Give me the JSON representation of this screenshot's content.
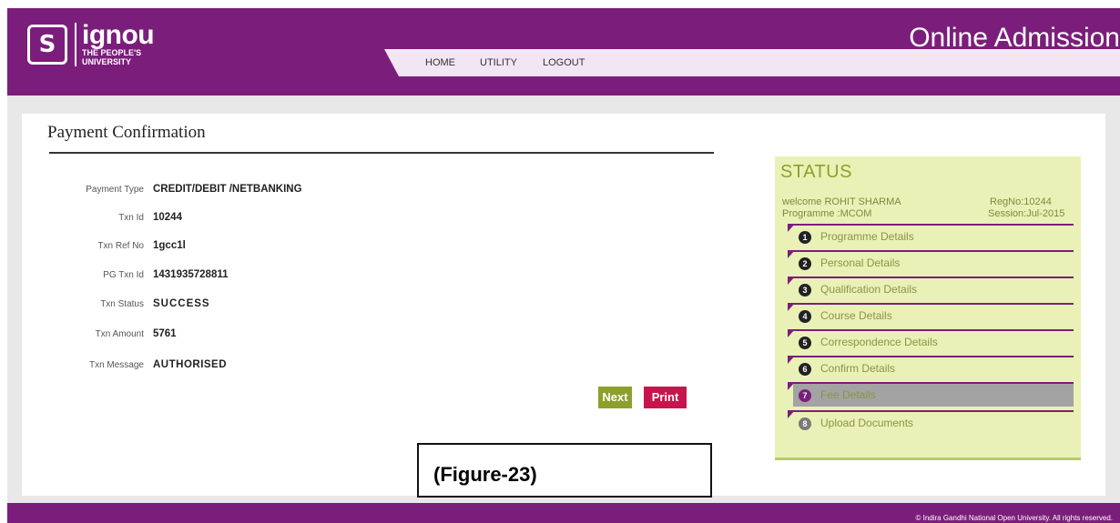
{
  "header": {
    "logo_mark": "S",
    "logo_name": "ignou",
    "logo_sub1": "THE PEOPLE'S",
    "logo_sub2": "UNIVERSITY",
    "title": "Online Admission",
    "nav": {
      "home": "HOME",
      "utility": "UTILITY",
      "logout": "LOGOUT"
    }
  },
  "payment": {
    "title": "Payment Confirmation",
    "rows": [
      {
        "label": "Payment Type",
        "value": "CREDIT/DEBIT /NETBANKING"
      },
      {
        "label": "Txn Id",
        "value": "10244"
      },
      {
        "label": "Txn Ref No",
        "value": "1gcc1l"
      },
      {
        "label": "PG Txn Id",
        "value": "1431935728811"
      },
      {
        "label": "Txn Status",
        "value": "SUCCESS"
      },
      {
        "label": "Txn Amount",
        "value": "5761"
      },
      {
        "label": "Txn Message",
        "value": "AUTHORISED"
      }
    ],
    "next_label": "Next",
    "print_label": "Print"
  },
  "status": {
    "title": "STATUS",
    "welcome": "welcome ROHIT SHARMA",
    "regno": "RegNo:10244",
    "programme": "Programme :MCOM",
    "session": "Session:Jul-2015",
    "items": [
      {
        "num": "1",
        "label": "Programme Details"
      },
      {
        "num": "2",
        "label": "Personal Details"
      },
      {
        "num": "3",
        "label": "Qualification Details"
      },
      {
        "num": "4",
        "label": "Course Details"
      },
      {
        "num": "5",
        "label": "Correspondence Details"
      },
      {
        "num": "6",
        "label": "Confirm Details"
      },
      {
        "num": "7",
        "label": "Fee Details"
      },
      {
        "num": "8",
        "label": "Upload Documents"
      }
    ]
  },
  "figure_label": "(Figure-23)",
  "footer": {
    "copyright": "© Indira Gandhi National Open University. All rights reserved."
  },
  "colors": {
    "brand": "#7b1e7b",
    "status_bg": "#eaf1b6",
    "next": "#8da02a",
    "print": "#c8144d"
  }
}
